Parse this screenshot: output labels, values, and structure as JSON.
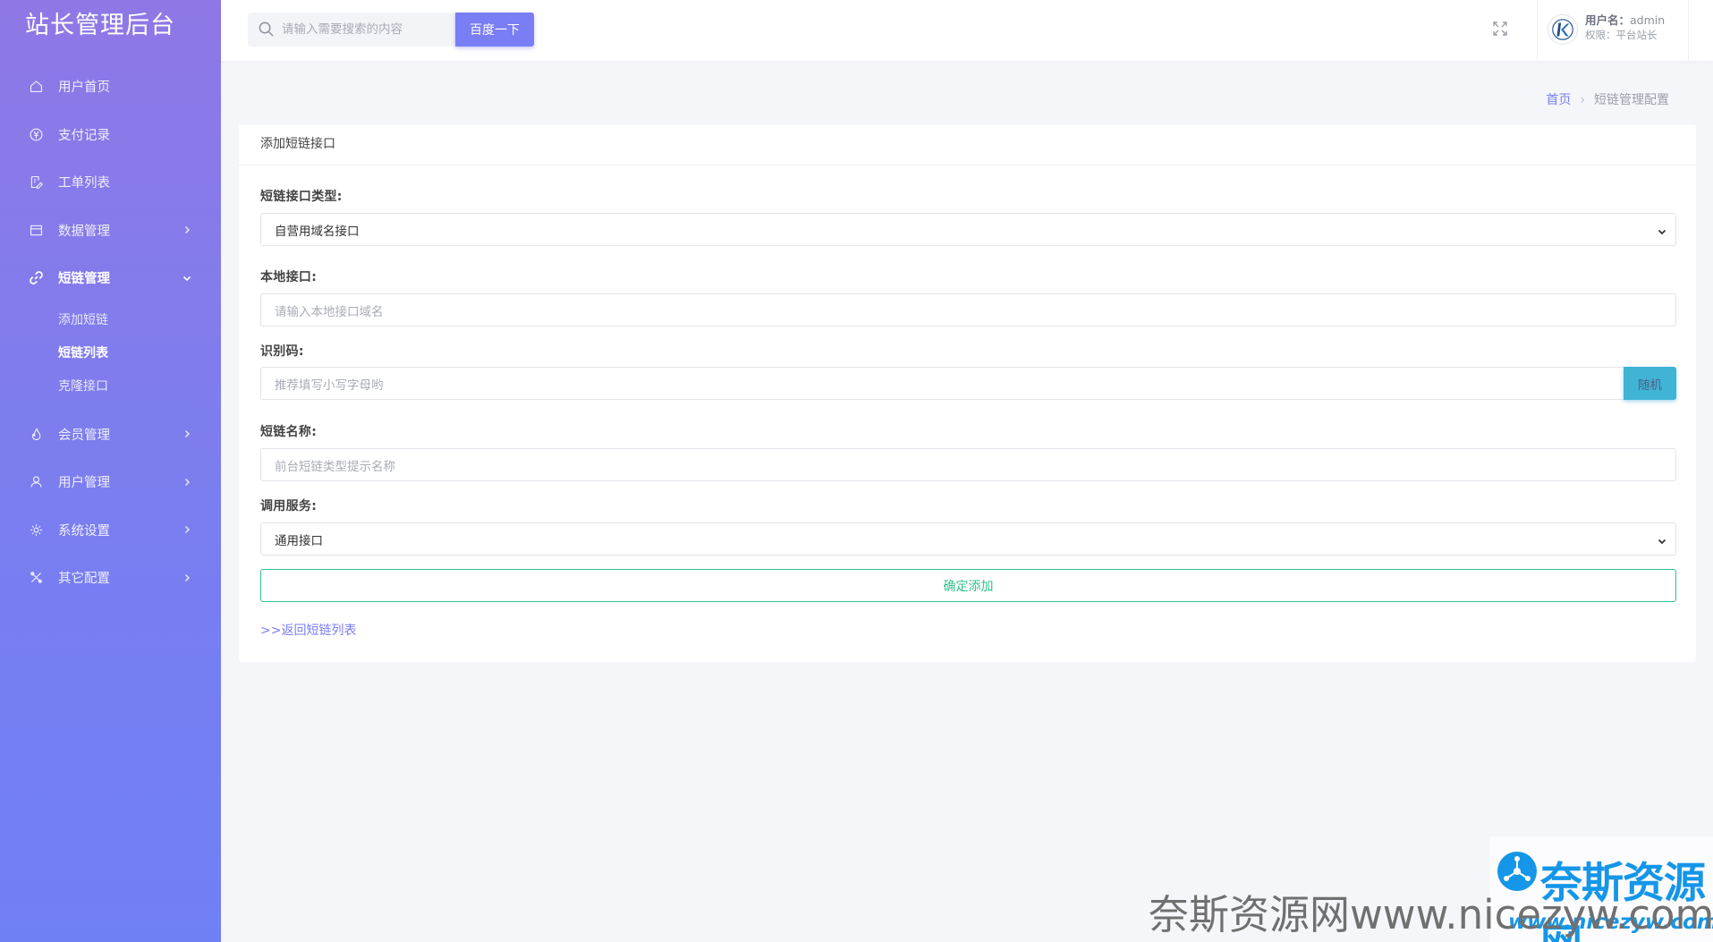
{
  "brand": "站长管理后台",
  "sidebar": {
    "items": [
      {
        "label": "用户首页"
      },
      {
        "label": "支付记录"
      },
      {
        "label": "工单列表"
      },
      {
        "label": "数据管理"
      },
      {
        "label": "短链管理"
      },
      {
        "label": "会员管理"
      },
      {
        "label": "用户管理"
      },
      {
        "label": "系统设置"
      },
      {
        "label": "其它配置"
      }
    ],
    "subitems": [
      {
        "label": "添加短链"
      },
      {
        "label": "短链列表"
      },
      {
        "label": "克隆接口"
      }
    ]
  },
  "header": {
    "search_placeholder": "请输入需要搜索的内容",
    "search_button": "百度一下",
    "username_label": "用户名：",
    "username": "admin",
    "role": "权限：平台站长"
  },
  "breadcrumb": {
    "home": "首页",
    "separator": "›",
    "current": "短链管理配置"
  },
  "card": {
    "title": "添加短链接口",
    "fields": {
      "type_label": "短链接口类型:",
      "type_value": "自营用域名接口",
      "local_label": "本地接口:",
      "local_placeholder": "请输入本地接口域名",
      "code_label": "识别码:",
      "code_placeholder": "推荐填写小写字母哟",
      "random_button": "随机",
      "name_label": "短链名称:",
      "name_placeholder": "前台短链类型提示名称",
      "service_label": "调用服务:",
      "service_value": "通用接口",
      "submit": "确定添加",
      "back_link": ">>返回短链列表"
    }
  },
  "watermark": {
    "logo": "奈斯资源网",
    "url_small": "www.nicezyw.com",
    "big": "奈斯资源网www.nicezyw.com"
  },
  "colors": {
    "accent": "#7a7ef5",
    "success": "#2ec28a",
    "info": "#3fb4d4",
    "watermark_blue": "#1596e8"
  }
}
